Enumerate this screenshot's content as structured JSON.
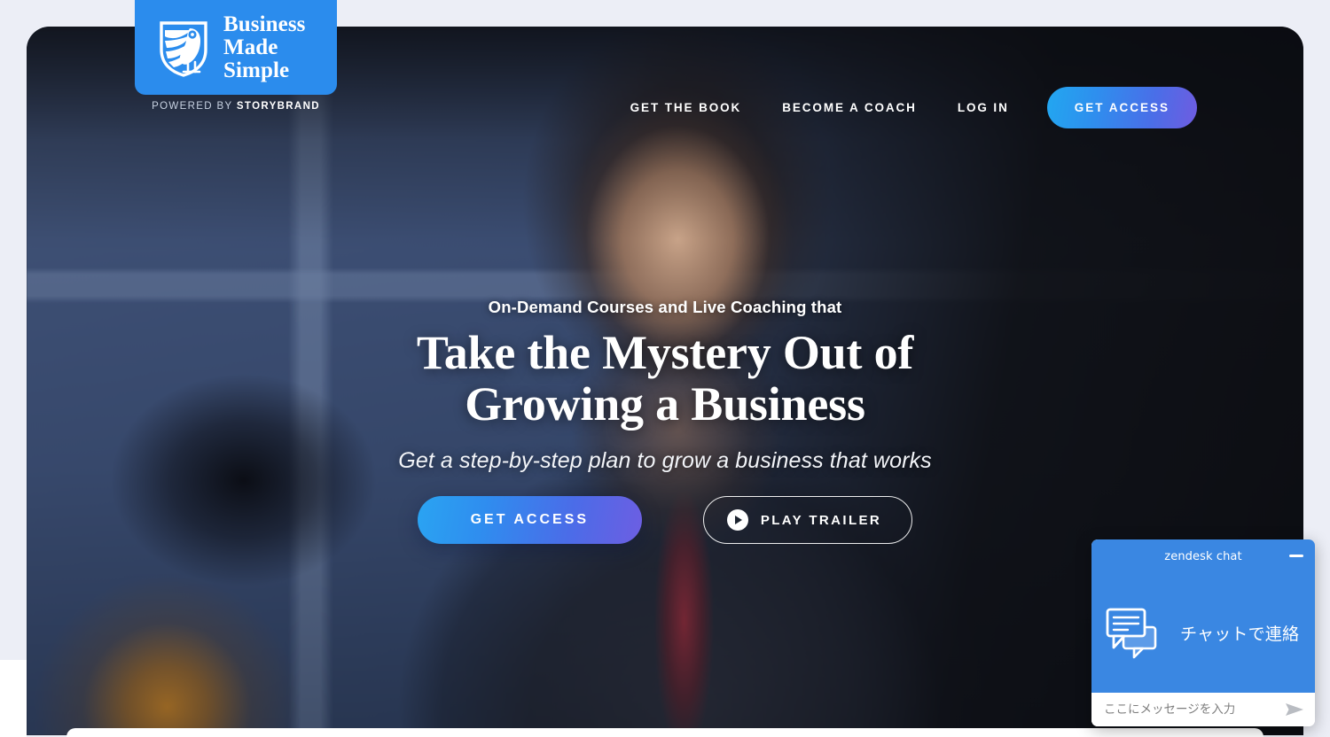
{
  "brand": {
    "logo_icon": "owl-shield-icon",
    "name_line1": "Business",
    "name_line2": "Made",
    "name_line3": "Simple",
    "powered_prefix": "POWERED BY ",
    "powered_strong": "STORYBRAND",
    "badge_color": "#2b8ced"
  },
  "nav": {
    "links": [
      {
        "label": "GET THE BOOK"
      },
      {
        "label": "BECOME A COACH"
      },
      {
        "label": "LOG IN"
      }
    ],
    "cta_label": "GET ACCESS",
    "cta_gradient_from": "#22a7f0",
    "cta_gradient_to": "#6f5ce0"
  },
  "hero": {
    "eyebrow": "On-Demand Courses and Live Coaching that",
    "headline_line1": "Take the Mystery Out of",
    "headline_line2": "Growing a Business",
    "subhead": "Get a step-by-step plan to grow a business that works",
    "primary_cta": "GET ACCESS",
    "secondary_cta": "PLAY TRAILER",
    "play_icon": "play-circle-icon"
  },
  "chat": {
    "title": "zendesk chat",
    "minimize_icon": "minimize-icon",
    "bubble_icon": "chat-bubbles-icon",
    "prompt": "チャットで連絡",
    "input_placeholder": "ここにメッセージを入力",
    "input_value": "",
    "send_icon": "send-icon",
    "accent_color": "#3a87e2"
  }
}
